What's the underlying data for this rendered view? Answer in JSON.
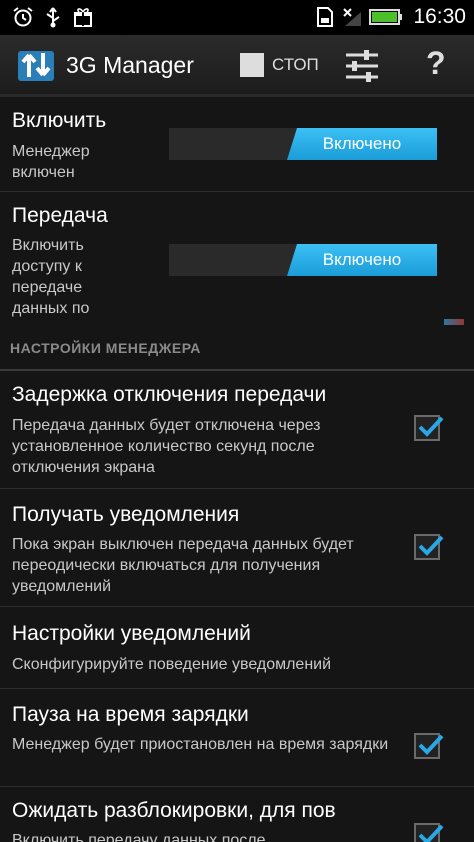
{
  "status_bar": {
    "time": "16:30",
    "icons": [
      "alarm-icon",
      "usb-icon",
      "gift-icon",
      "sd-card-icon",
      "signal-off-icon",
      "battery-icon"
    ]
  },
  "action_bar": {
    "title": "3G Manager",
    "stop_label": "СТОП",
    "icons": [
      "app-logo-icon",
      "stop-square-icon",
      "settings-sliders-icon",
      "help-icon"
    ],
    "help_glyph": "?"
  },
  "toggles": [
    {
      "title": "Включить",
      "summary": "Менеджер включен",
      "state": "Включено"
    },
    {
      "title": "Передача",
      "summary": "Включить доступу к передаче данных по",
      "state": "Включено"
    }
  ],
  "section_header": "НАСТРОЙКИ МЕНЕДЖЕРА",
  "settings": [
    {
      "title": "Задержка отключения передачи",
      "summary": "Передача данных будет отключена через установленное количество секунд после отключения экрана",
      "checked": true
    },
    {
      "title": "Получать уведомления",
      "summary": "Пока экран выключен передача данных будет переодически включаться для получения уведомлений",
      "checked": true
    },
    {
      "title": "Настройки уведомлений",
      "summary": "Сконфигурируйте поведение уведомлений",
      "checked": null
    },
    {
      "title": "Пауза на время зарядки",
      "summary": "Менеджер будет приостановлен на время зарядки",
      "checked": true
    },
    {
      "title": "Ожидать разблокировки, для пов",
      "summary": "Включить передачу данных после",
      "checked": true
    }
  ],
  "colors": {
    "accent": "#1a9cd8",
    "background": "#151515",
    "section_header": "#8a8a8a"
  }
}
